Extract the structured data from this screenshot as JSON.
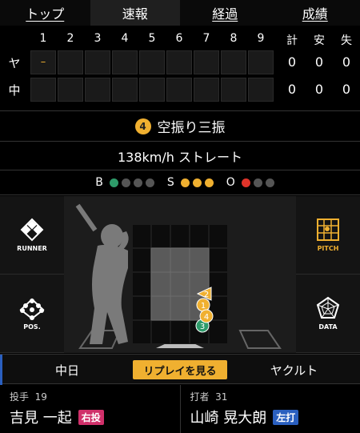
{
  "tabs": [
    {
      "label": "トップ",
      "active": false
    },
    {
      "label": "速報",
      "active": true
    },
    {
      "label": "経過",
      "active": false
    },
    {
      "label": "成績",
      "active": false
    }
  ],
  "scoreboard": {
    "innings": [
      "1",
      "2",
      "3",
      "4",
      "5",
      "6",
      "7",
      "8",
      "9"
    ],
    "total_headers": [
      "計",
      "安",
      "失"
    ],
    "teams": [
      {
        "name": "ヤ",
        "first_cell": "–",
        "totals": [
          "0",
          "0",
          "0"
        ]
      },
      {
        "name": "中",
        "first_cell": "",
        "totals": [
          "0",
          "0",
          "0"
        ]
      }
    ]
  },
  "play": {
    "badge": "4",
    "result": "空振り三振",
    "pitch": "138km/h ストレート"
  },
  "count": {
    "b_label": "B",
    "s_label": "S",
    "o_label": "O",
    "balls": 1,
    "strikes": 3,
    "outs": 1,
    "ball_color": "#2e9b6a",
    "strike_color": "#f0b030",
    "out_color": "#e0342a"
  },
  "field": {
    "buttons": {
      "runner": "RUNNER",
      "pos": "POS.",
      "pitch": "PITCH",
      "data": "DATA"
    },
    "pitches": [
      {
        "n": "1",
        "color": "#f0b030"
      },
      {
        "n": "2",
        "color": "#f0b030"
      },
      {
        "n": "3",
        "color": "#2e9b6a"
      },
      {
        "n": "4",
        "color": "#f0b030"
      }
    ]
  },
  "teambar": {
    "home": "中日",
    "replay": "リプレイを見る",
    "away": "ヤクルト"
  },
  "pitcher": {
    "role": "投手",
    "number": "19",
    "name": "吉見 一起",
    "hand": "右投"
  },
  "batter": {
    "role": "打者",
    "number": "31",
    "name": "山崎 晃大朗",
    "hand": "左打"
  }
}
